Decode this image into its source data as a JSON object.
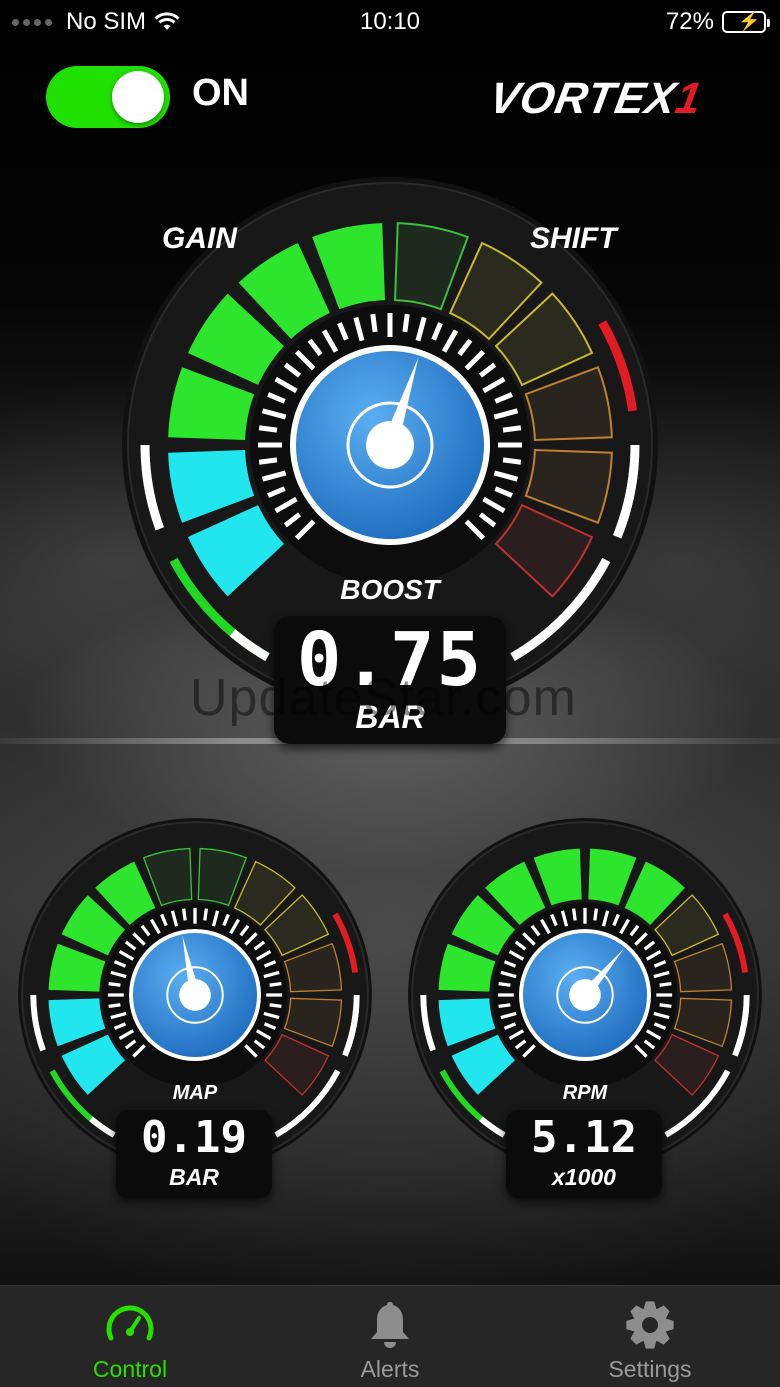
{
  "status_bar": {
    "carrier": "No SIM",
    "time": "10:10",
    "battery_percent": "72%",
    "battery_level": 0.72
  },
  "header": {
    "toggle_state_label": "ON",
    "toggle_on": true,
    "logo_main": "VORTEX",
    "logo_accent": "1"
  },
  "main_gauge": {
    "left_label": "GAIN",
    "right_label": "SHIFT",
    "name": "BOOST",
    "value": "0.75",
    "unit": "BAR"
  },
  "small_gauges": [
    {
      "name": "MAP",
      "value": "0.19",
      "unit": "BAR"
    },
    {
      "name": "RPM",
      "value": "5.12",
      "unit": "x1000"
    }
  ],
  "watermark": "UpdateStar.com",
  "tabbar": {
    "tabs": [
      {
        "label": "Control",
        "icon": "speedometer-icon",
        "active": true
      },
      {
        "label": "Alerts",
        "icon": "bell-icon",
        "active": false
      },
      {
        "label": "Settings",
        "icon": "gear-icon",
        "active": false
      }
    ]
  },
  "colors": {
    "accent_green": "#27e000",
    "segment_green": "#2ee52e",
    "segment_cyan": "#22e6ee",
    "warning_red": "#e31b23",
    "dial_blue": "#3a8fe0"
  }
}
